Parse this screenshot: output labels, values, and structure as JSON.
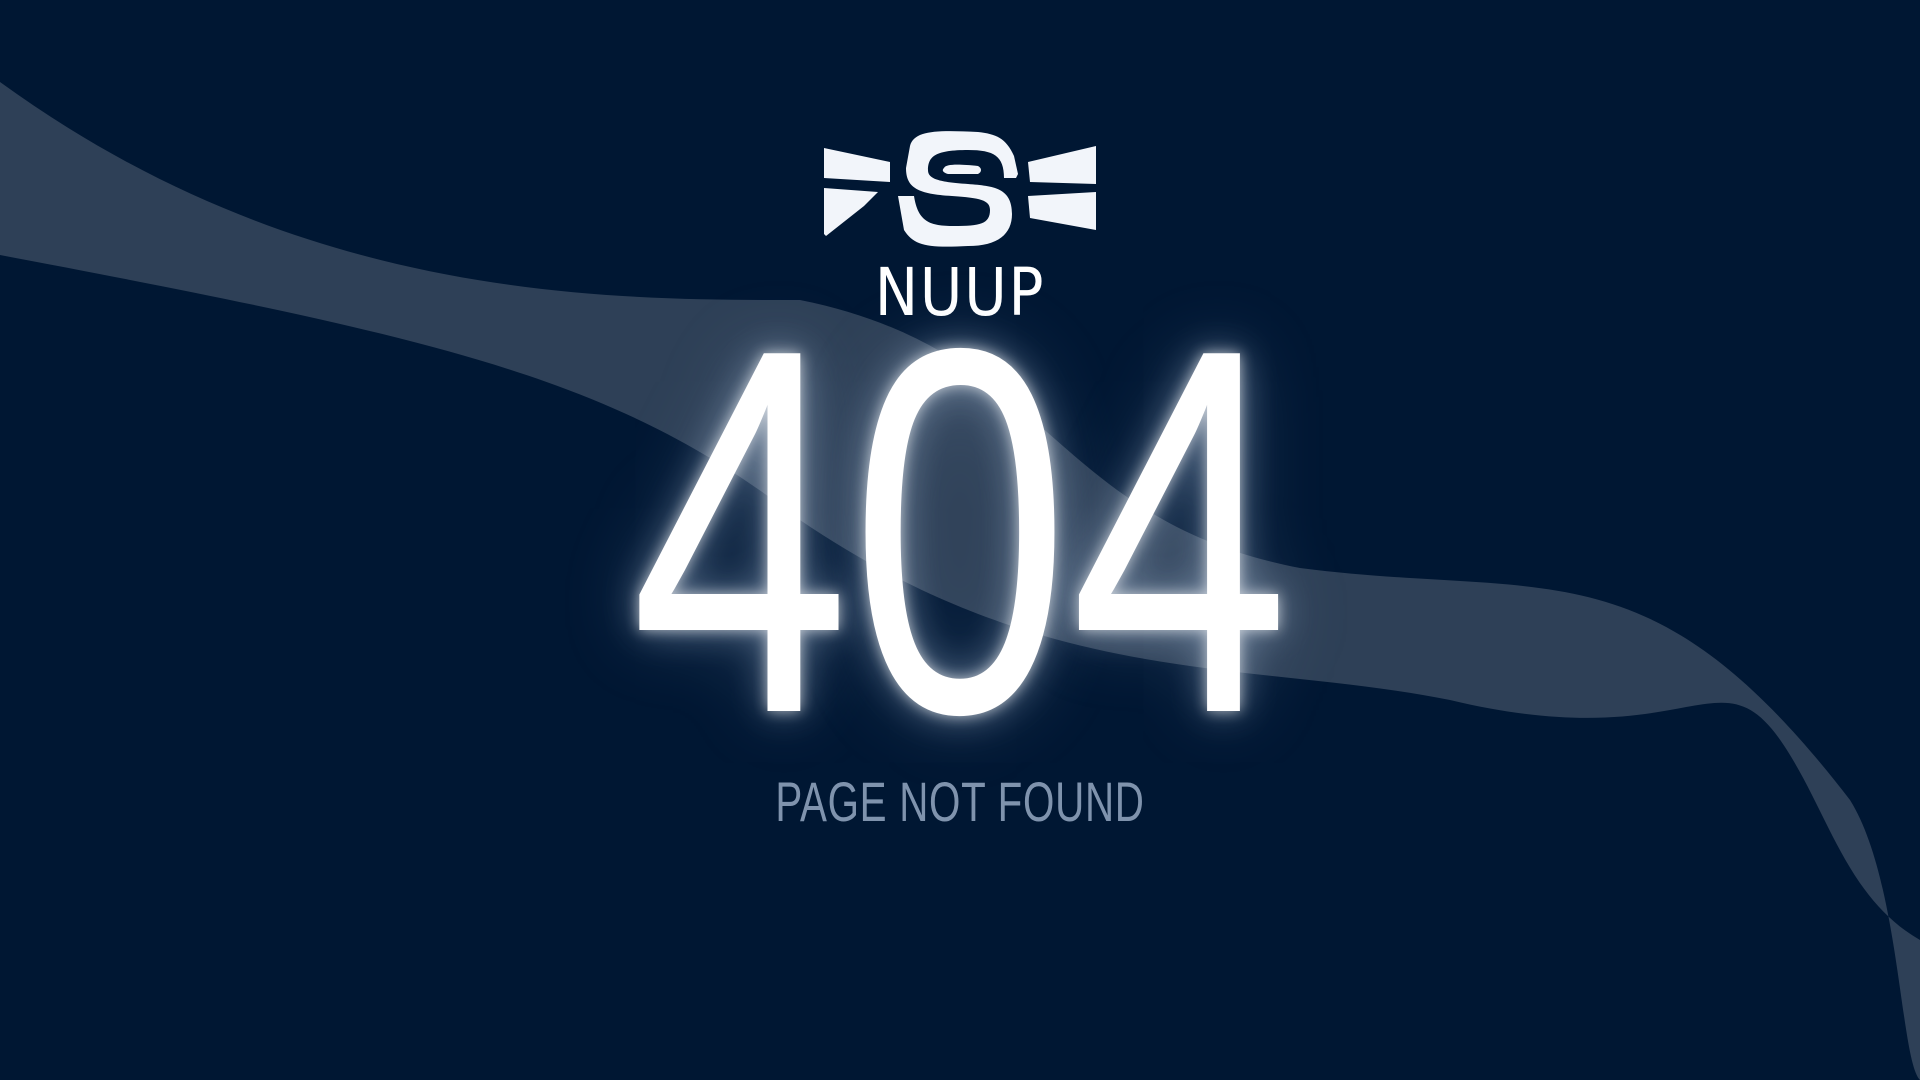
{
  "page": {
    "brand_name": "NUUP",
    "error_code": "404",
    "message": "PAGE NOT FOUND"
  },
  "icons": {
    "logo": "nuup-logo-icon"
  },
  "colors": {
    "background": "#001733",
    "wave": "#2e4057",
    "text_primary": "#ffffff",
    "text_secondary": "#7f93ad"
  }
}
